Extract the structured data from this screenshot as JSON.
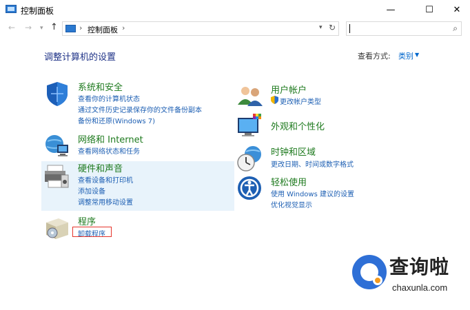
{
  "window": {
    "title": "控制面板",
    "minimize_glyph": "—",
    "maximize_glyph": "☐",
    "close_glyph": "✕"
  },
  "nav": {
    "back_glyph": "←",
    "forward_glyph": "→",
    "dropdown_glyph": "▾",
    "up_glyph": "↑",
    "address_separator": "›",
    "address_path": "控制面板",
    "refresh_glyph": "↻",
    "search_placeholder": "",
    "search_glyph": "⌕"
  },
  "header": {
    "page_title": "调整计算机的设置",
    "view_by_label": "查看方式:",
    "view_by_value": "类别",
    "view_by_caret": "▼"
  },
  "categories": {
    "system_security": {
      "title": "系统和安全",
      "links": [
        "查看你的计算机状态",
        "通过文件历史记录保存你的文件备份副本",
        "备份和还原(Windows 7)"
      ]
    },
    "network": {
      "title": "网络和 Internet",
      "links": [
        "查看网络状态和任务"
      ]
    },
    "hardware": {
      "title": "硬件和声音",
      "links": [
        "查看设备和打印机",
        "添加设备",
        "调整常用移动设置"
      ]
    },
    "programs": {
      "title": "程序",
      "links": [
        "卸载程序"
      ]
    },
    "user_accounts": {
      "title": "用户帐户",
      "links": [
        "更改帐户类型"
      ]
    },
    "appearance": {
      "title": "外观和个性化",
      "links": []
    },
    "clock_region": {
      "title": "时钟和区域",
      "links": [
        "更改日期、时间或数字格式"
      ]
    },
    "ease_access": {
      "title": "轻松使用",
      "links": [
        "使用 Windows 建议的设置",
        "优化视觉显示"
      ]
    }
  },
  "watermark": {
    "brand": "查询啦",
    "url": "chaxunla.com"
  },
  "colors": {
    "link": "#1d5fb3",
    "category_title": "#1e7a1e",
    "page_title": "#1e3287",
    "highlight": "#e8f3fb",
    "annotation_red": "#e5332a"
  }
}
